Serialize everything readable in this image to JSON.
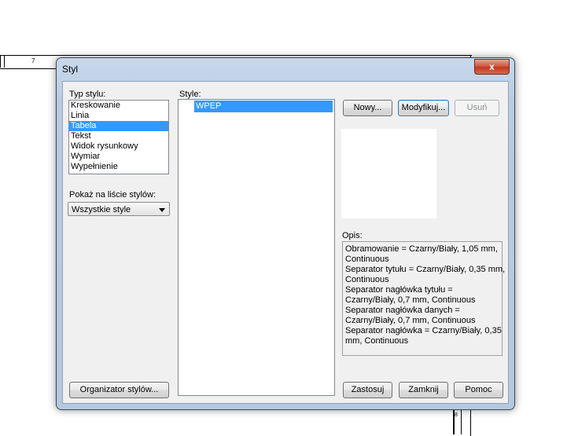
{
  "background": {
    "cell_number_1": "7",
    "cell_number_2": "8"
  },
  "dialog": {
    "title": "Styl",
    "close_label": "x",
    "style_type": {
      "label": "Typ stylu:",
      "items": [
        "Kreskowanie",
        "Linia",
        "Tabela",
        "Tekst",
        "Widok rysunkowy",
        "Wymiar",
        "Wypełnienie"
      ],
      "selected": "Tabela"
    },
    "show_list": {
      "label": "Pokaż na liście stylów:",
      "value": "Wszystkie style"
    },
    "styles": {
      "label": "Style:",
      "items": [
        "WPEP"
      ],
      "selected": "WPEP"
    },
    "buttons": {
      "new": "Nowy...",
      "modify": "Modyfikuj...",
      "delete": "Usuń",
      "organizer": "Organizator stylów...",
      "apply": "Zastosuj",
      "close": "Zamknij",
      "help": "Pomoc"
    },
    "description": {
      "label": "Opis:",
      "lines": [
        "Obramowanie = Czarny/Biały, 1,05 mm,",
        "Continuous",
        "Separator tytułu = Czarny/Biały, 0,35 mm,",
        "Continuous",
        "Separator nagłówka tytułu =",
        "Czarny/Biały, 0,7 mm, Continuous",
        "Separator nagłówka danych =",
        "Czarny/Biały, 0,7 mm, Continuous",
        "Separator nagłówka = Czarny/Biały, 0,35",
        "mm, Continuous"
      ]
    },
    "colors": {
      "selection": "#3399ff",
      "frame": "#b9cce4"
    }
  }
}
